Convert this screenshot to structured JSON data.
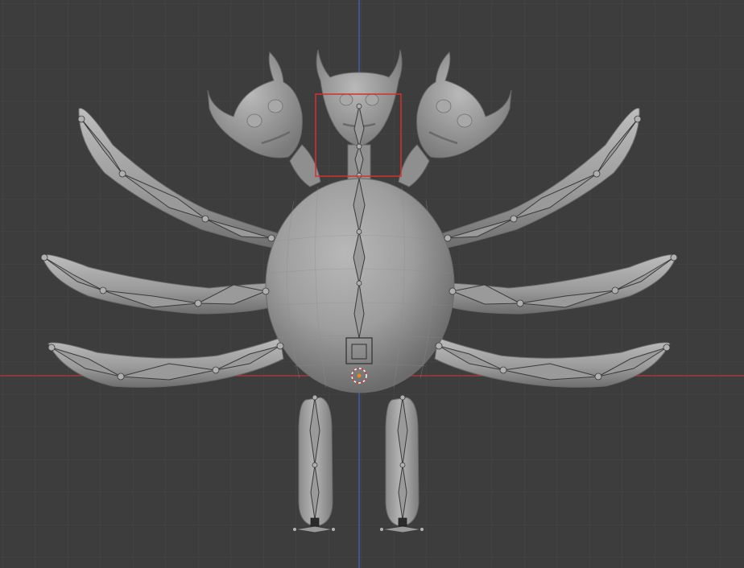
{
  "viewport": {
    "view": "front-orthographic",
    "mode": "pose",
    "background": "#3d3d3d",
    "grid_color": "#4a4a4a",
    "x_axis_color": "#c23b3b",
    "z_axis_color": "#3b5fc2",
    "mesh_color": "#9a9a9a",
    "selection_color": "#d43030",
    "cursor_color": "#e08a20"
  },
  "scene": {
    "object": "monster-mesh",
    "armature_visible": true,
    "selected_bone_frame": "head-center-selection-frame"
  }
}
